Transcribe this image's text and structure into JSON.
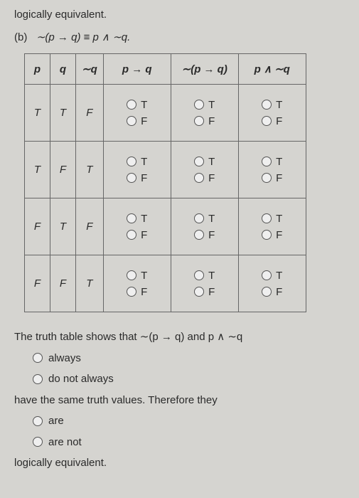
{
  "intro": "logically equivalent.",
  "part_b_label": "(b)",
  "part_b_formula": "∼(p → q) ≡ p ∧ ∼q.",
  "headers": {
    "p": "p",
    "q": "q",
    "nq": "∼q",
    "p_imp_q": "p → q",
    "neg_p_imp_q": "∼(p → q)",
    "p_and_nq": "p ∧ ∼q"
  },
  "rows": [
    {
      "p": "T",
      "q": "T",
      "nq": "F"
    },
    {
      "p": "T",
      "q": "F",
      "nq": "T"
    },
    {
      "p": "F",
      "q": "T",
      "nq": "F"
    },
    {
      "p": "F",
      "q": "F",
      "nq": "T"
    }
  ],
  "opts": {
    "t": "T",
    "f": "F"
  },
  "concl": {
    "line1": "The truth table shows that ∼(p → q) and p ∧ ∼q",
    "always": "always",
    "donot": "do not always",
    "line2": "have the same truth values. Therefore they",
    "are": "are",
    "arenot": "are not",
    "line3": "logically equivalent."
  }
}
